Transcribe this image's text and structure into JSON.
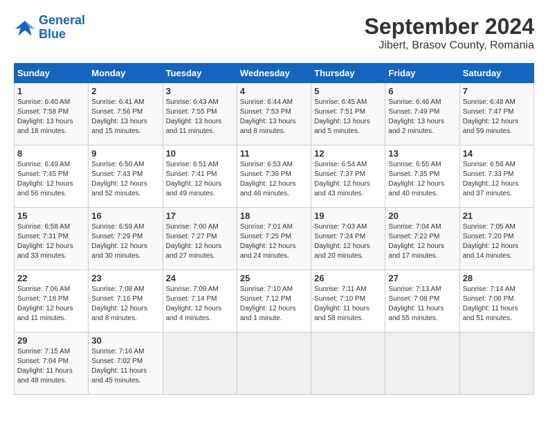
{
  "logo": {
    "line1": "General",
    "line2": "Blue"
  },
  "title": "September 2024",
  "subtitle": "Jibert, Brasov County, Romania",
  "weekdays": [
    "Sunday",
    "Monday",
    "Tuesday",
    "Wednesday",
    "Thursday",
    "Friday",
    "Saturday"
  ],
  "weeks": [
    [
      {
        "day": "1",
        "info": "Sunrise: 6:40 AM\nSunset: 7:58 PM\nDaylight: 13 hours\nand 18 minutes."
      },
      {
        "day": "2",
        "info": "Sunrise: 6:41 AM\nSunset: 7:56 PM\nDaylight: 13 hours\nand 15 minutes."
      },
      {
        "day": "3",
        "info": "Sunrise: 6:43 AM\nSunset: 7:55 PM\nDaylight: 13 hours\nand 11 minutes."
      },
      {
        "day": "4",
        "info": "Sunrise: 6:44 AM\nSunset: 7:53 PM\nDaylight: 13 hours\nand 8 minutes."
      },
      {
        "day": "5",
        "info": "Sunrise: 6:45 AM\nSunset: 7:51 PM\nDaylight: 13 hours\nand 5 minutes."
      },
      {
        "day": "6",
        "info": "Sunrise: 6:46 AM\nSunset: 7:49 PM\nDaylight: 13 hours\nand 2 minutes."
      },
      {
        "day": "7",
        "info": "Sunrise: 6:48 AM\nSunset: 7:47 PM\nDaylight: 12 hours\nand 59 minutes."
      }
    ],
    [
      {
        "day": "8",
        "info": "Sunrise: 6:49 AM\nSunset: 7:45 PM\nDaylight: 12 hours\nand 56 minutes."
      },
      {
        "day": "9",
        "info": "Sunrise: 6:50 AM\nSunset: 7:43 PM\nDaylight: 12 hours\nand 52 minutes."
      },
      {
        "day": "10",
        "info": "Sunrise: 6:51 AM\nSunset: 7:41 PM\nDaylight: 12 hours\nand 49 minutes."
      },
      {
        "day": "11",
        "info": "Sunrise: 6:53 AM\nSunset: 7:39 PM\nDaylight: 12 hours\nand 46 minutes."
      },
      {
        "day": "12",
        "info": "Sunrise: 6:54 AM\nSunset: 7:37 PM\nDaylight: 12 hours\nand 43 minutes."
      },
      {
        "day": "13",
        "info": "Sunrise: 6:55 AM\nSunset: 7:35 PM\nDaylight: 12 hours\nand 40 minutes."
      },
      {
        "day": "14",
        "info": "Sunrise: 6:56 AM\nSunset: 7:33 PM\nDaylight: 12 hours\nand 37 minutes."
      }
    ],
    [
      {
        "day": "15",
        "info": "Sunrise: 6:58 AM\nSunset: 7:31 PM\nDaylight: 12 hours\nand 33 minutes."
      },
      {
        "day": "16",
        "info": "Sunrise: 6:59 AM\nSunset: 7:29 PM\nDaylight: 12 hours\nand 30 minutes."
      },
      {
        "day": "17",
        "info": "Sunrise: 7:00 AM\nSunset: 7:27 PM\nDaylight: 12 hours\nand 27 minutes."
      },
      {
        "day": "18",
        "info": "Sunrise: 7:01 AM\nSunset: 7:25 PM\nDaylight: 12 hours\nand 24 minutes."
      },
      {
        "day": "19",
        "info": "Sunrise: 7:03 AM\nSunset: 7:24 PM\nDaylight: 12 hours\nand 20 minutes."
      },
      {
        "day": "20",
        "info": "Sunrise: 7:04 AM\nSunset: 7:22 PM\nDaylight: 12 hours\nand 17 minutes."
      },
      {
        "day": "21",
        "info": "Sunrise: 7:05 AM\nSunset: 7:20 PM\nDaylight: 12 hours\nand 14 minutes."
      }
    ],
    [
      {
        "day": "22",
        "info": "Sunrise: 7:06 AM\nSunset: 7:18 PM\nDaylight: 12 hours\nand 11 minutes."
      },
      {
        "day": "23",
        "info": "Sunrise: 7:08 AM\nSunset: 7:16 PM\nDaylight: 12 hours\nand 8 minutes."
      },
      {
        "day": "24",
        "info": "Sunrise: 7:09 AM\nSunset: 7:14 PM\nDaylight: 12 hours\nand 4 minutes."
      },
      {
        "day": "25",
        "info": "Sunrise: 7:10 AM\nSunset: 7:12 PM\nDaylight: 12 hours\nand 1 minute."
      },
      {
        "day": "26",
        "info": "Sunrise: 7:11 AM\nSunset: 7:10 PM\nDaylight: 11 hours\nand 58 minutes."
      },
      {
        "day": "27",
        "info": "Sunrise: 7:13 AM\nSunset: 7:08 PM\nDaylight: 11 hours\nand 55 minutes."
      },
      {
        "day": "28",
        "info": "Sunrise: 7:14 AM\nSunset: 7:06 PM\nDaylight: 11 hours\nand 51 minutes."
      }
    ],
    [
      {
        "day": "29",
        "info": "Sunrise: 7:15 AM\nSunset: 7:04 PM\nDaylight: 11 hours\nand 48 minutes."
      },
      {
        "day": "30",
        "info": "Sunrise: 7:16 AM\nSunset: 7:02 PM\nDaylight: 11 hours\nand 45 minutes."
      },
      {
        "day": "",
        "info": ""
      },
      {
        "day": "",
        "info": ""
      },
      {
        "day": "",
        "info": ""
      },
      {
        "day": "",
        "info": ""
      },
      {
        "day": "",
        "info": ""
      }
    ]
  ]
}
